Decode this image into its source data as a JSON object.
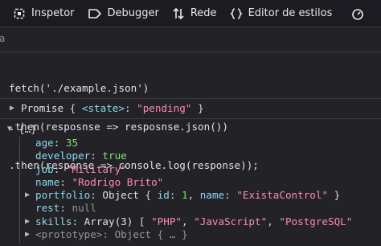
{
  "toolbar": {
    "items": [
      {
        "icon": "inspector-icon",
        "label": "Inspetor"
      },
      {
        "icon": "debugger-icon",
        "label": "Debugger"
      },
      {
        "icon": "network-icon",
        "label": "Rede"
      },
      {
        "icon": "style-editor-icon",
        "label": "Editor de estilos"
      }
    ]
  },
  "filter": {
    "placeholder_fragment": "a"
  },
  "input": {
    "lines": [
      "fetch('./example.json')",
      ".then(resposnse => resposnse.json())",
      ".then(response => console.log(response));"
    ]
  },
  "promise": {
    "label": "Promise",
    "open_brace": "{",
    "state_key": "<state>",
    "colon": ":",
    "state_value": "\"pending\"",
    "close_brace": "}"
  },
  "object": {
    "summary": "{…}",
    "fields": [
      {
        "key": "age",
        "value": "35"
      },
      {
        "key": "developer",
        "value": "true"
      },
      {
        "key": "job",
        "value": "\"Military\""
      },
      {
        "key": "name",
        "value": "\"Rodrigo Brito\""
      }
    ],
    "portfolio": {
      "key": "portfolio",
      "type": "Object",
      "id_key": "id",
      "id_value": "1",
      "name_key": "name",
      "name_value": "\"ExistaControl\""
    },
    "rest": {
      "key": "rest",
      "value": "null"
    },
    "skills": {
      "key": "skills",
      "type": "Array(3)",
      "items": [
        "\"PHP\"",
        "\"JavaScript\"",
        "\"PostgreSQL\""
      ]
    },
    "prototype": {
      "key": "<prototype>",
      "value": "Object { … }"
    }
  }
}
